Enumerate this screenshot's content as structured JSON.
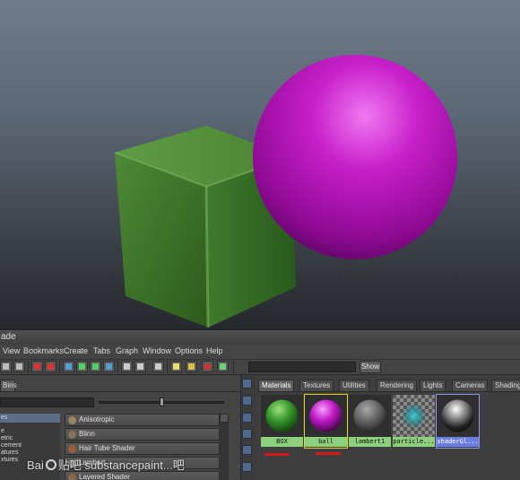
{
  "window": {
    "title": "ade"
  },
  "menubar": [
    "View",
    "Bookmarks",
    "Create",
    "Tabs",
    "Graph",
    "Window",
    "Options",
    "Help"
  ],
  "toolbar": {
    "show_label": "Show"
  },
  "left_panel": {
    "bins_tab": "Bins",
    "categories": [
      {
        "label": "es",
        "selected": true
      },
      {
        "label": "e",
        "selected": false
      },
      {
        "label": "etric",
        "selected": false
      },
      {
        "label": "cement",
        "selected": false
      },
      {
        "label": "atures",
        "selected": false
      },
      {
        "label": "xtures",
        "selected": false
      }
    ],
    "shaders": [
      {
        "label": "Anisotropic",
        "color": "#9a8460"
      },
      {
        "label": "Blinn",
        "color": "#8a7356"
      },
      {
        "label": "Hair Tube Shader",
        "color": "#a05a3a"
      },
      {
        "label": "Lambert",
        "color": "#777777"
      },
      {
        "label": "Layered Shader",
        "color": "#8a6a4a"
      }
    ]
  },
  "right_panel": {
    "tabs": [
      "Materials",
      "Textures",
      "Utilities",
      "Rendering",
      "Lights",
      "Cameras",
      "Shading"
    ],
    "active_tab": "Materials",
    "materials": [
      {
        "label": "BOX",
        "color": "#3a9a2e",
        "style": "green"
      },
      {
        "label": "ball",
        "color": "#c21ac8",
        "style": "ball"
      },
      {
        "label": "lambert1",
        "color": "#6a6a6a",
        "style": "green"
      },
      {
        "label": "particle...",
        "color": "#3aa8b0",
        "style": "green"
      },
      {
        "label": "shaderGl...",
        "color": "#e8e8e8",
        "style": "blue"
      }
    ]
  },
  "watermark": {
    "brand": "Bai",
    "brand2": "du",
    "site": "贴吧",
    "text": "substancepaint...吧"
  }
}
